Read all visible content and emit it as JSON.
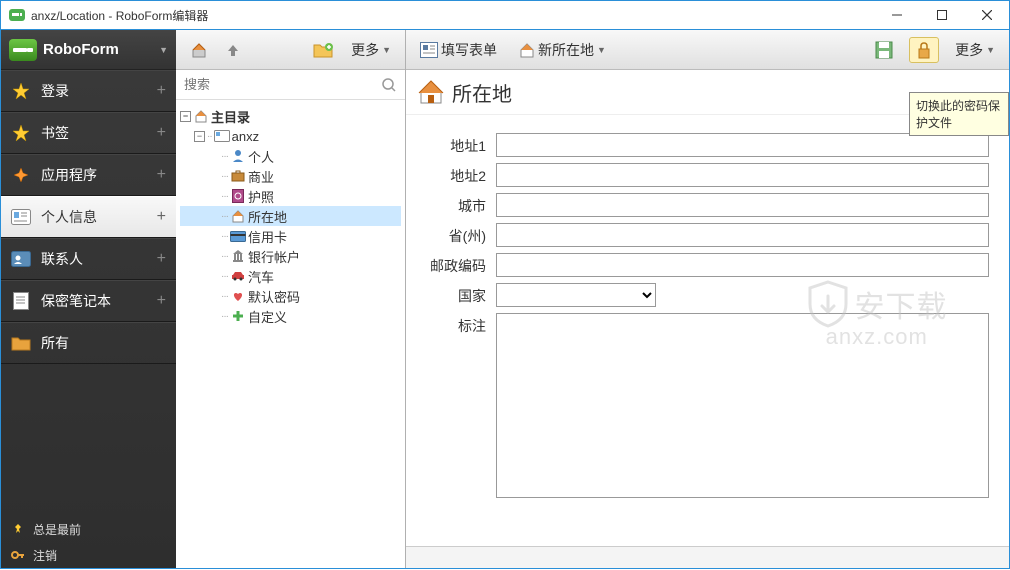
{
  "window": {
    "title": "anxz/Location - RoboForm编辑器"
  },
  "brand": {
    "name": "RoboForm"
  },
  "sidebar": {
    "items": [
      {
        "label": "登录"
      },
      {
        "label": "书签"
      },
      {
        "label": "应用程序"
      },
      {
        "label": "个人信息"
      },
      {
        "label": "联系人"
      },
      {
        "label": "保密笔记本"
      },
      {
        "label": "所有"
      }
    ],
    "footer": [
      {
        "label": "总是最前"
      },
      {
        "label": "注销"
      }
    ]
  },
  "tree_toolbar": {
    "more": "更多"
  },
  "search": {
    "placeholder": "搜索"
  },
  "tree": {
    "root": "主目录",
    "folder": "anxz",
    "items": [
      "个人",
      "商业",
      "护照",
      "所在地",
      "信用卡",
      "银行帐户",
      "汽车",
      "默认密码",
      "自定义"
    ]
  },
  "main_toolbar": {
    "fill_form": "填写表单",
    "new_location": "新所在地",
    "more": "更多"
  },
  "tooltip": "切换此的密码保护文件",
  "form": {
    "title": "所在地",
    "labels": {
      "addr1": "地址1",
      "addr2": "地址2",
      "city": "城市",
      "state": "省(州)",
      "zip": "邮政编码",
      "country": "国家",
      "note": "标注"
    },
    "values": {
      "addr1": "",
      "addr2": "",
      "city": "",
      "state": "",
      "zip": "",
      "country": "",
      "note": ""
    }
  },
  "watermark": {
    "main": "安下载",
    "sub": "anxz.com"
  }
}
